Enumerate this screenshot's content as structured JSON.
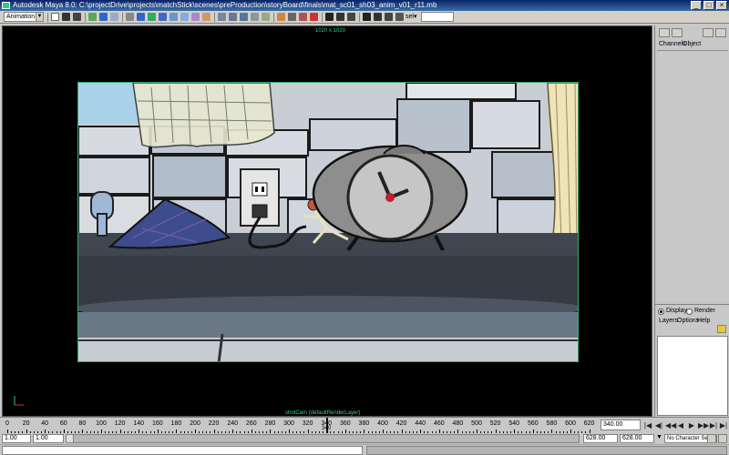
{
  "window": {
    "title": "Autodesk Maya 8.0: C:\\projectDrive\\projects\\matchStick\\scenes\\preProduction\\storyBoard\\finals\\mat_sc01_sh03_anim_v01_r11.mb",
    "minimize": "_",
    "maximize": "□",
    "close": "×"
  },
  "shelf": {
    "mode": "Animation",
    "sel_label": "sel▾",
    "sel_value": ""
  },
  "viewport": {
    "resolution_gate": "1020 x 1020",
    "camera": "shotCam (defaultRenderLayer)",
    "axis_x": "x",
    "axis_y": "y"
  },
  "channel_box": {
    "menu": [
      "Channels",
      "Object"
    ]
  },
  "layer_editor": {
    "display": "Display",
    "render": "Render",
    "menu": [
      "Layers",
      "Options",
      "Help"
    ]
  },
  "timeslider": {
    "ticks": [
      "0",
      "20",
      "40",
      "60",
      "80",
      "100",
      "120",
      "140",
      "160",
      "180",
      "200",
      "220",
      "240",
      "260",
      "280",
      "300",
      "320",
      "340",
      "360",
      "380",
      "400",
      "420",
      "440",
      "460",
      "480",
      "500",
      "520",
      "540",
      "560",
      "580",
      "600",
      "620"
    ],
    "current_frame": "340.00",
    "current_frame_label": "340",
    "current_frame_sub": "340",
    "playback": [
      "|◀",
      "◀|",
      "◀◀",
      "◀",
      "▶",
      "▶▶",
      "▶|",
      "▶|"
    ]
  },
  "range": {
    "start": "1.00",
    "playback_start": "1.00",
    "playback_end": "628.00",
    "end": "628.00",
    "character_set": "No Character Set"
  },
  "colors": {
    "titlebar": "#0a246a",
    "viewport_bg": "#000000",
    "hud_green": "#33cc99",
    "frame_marker": "#000000"
  }
}
